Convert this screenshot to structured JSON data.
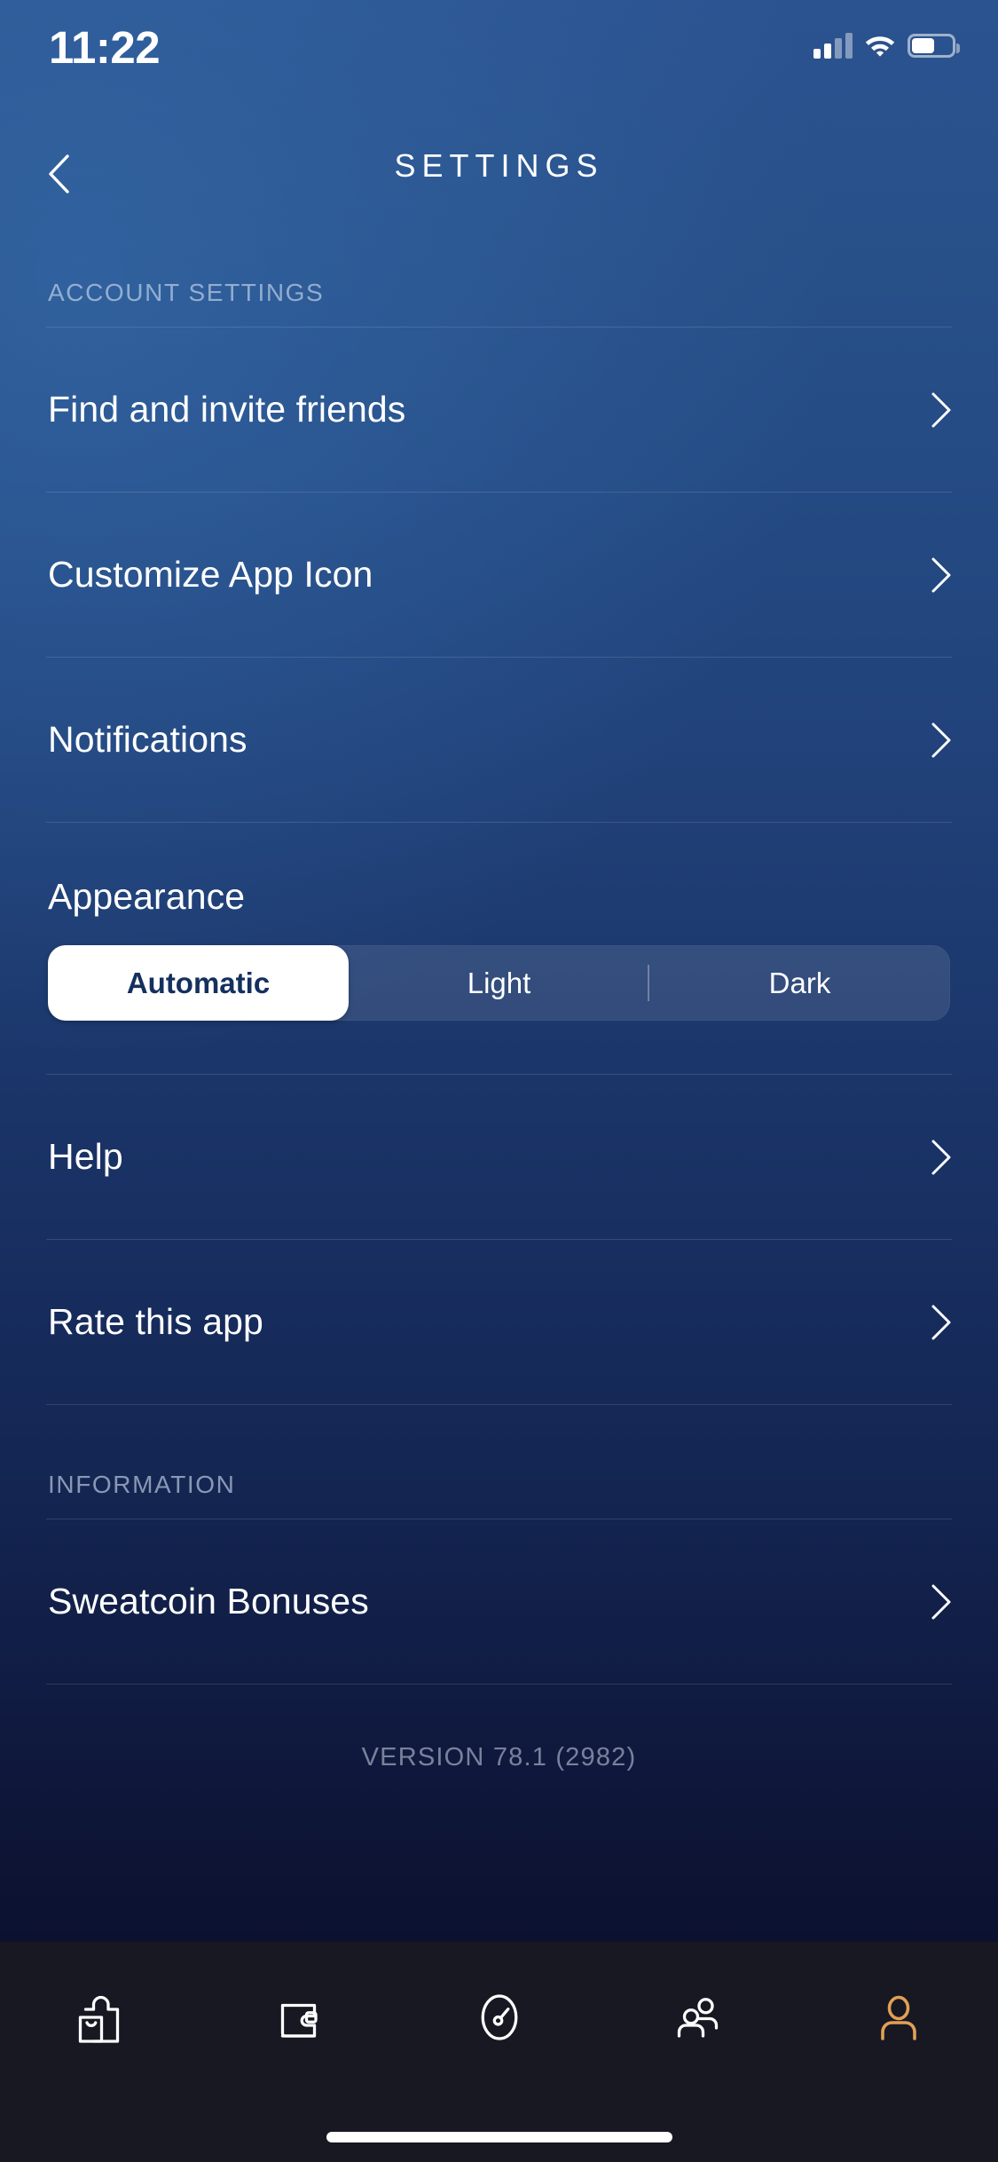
{
  "status_bar": {
    "time": "11:22",
    "signal_icon": "cellular-signal-icon",
    "signal_bars_filled": 2,
    "signal_bars_total": 4,
    "wifi_icon": "wifi-icon",
    "battery_icon": "battery-icon",
    "battery_level_percent": 56
  },
  "header": {
    "back_icon": "chevron-left-icon",
    "title": "SETTINGS"
  },
  "sections": [
    {
      "id": "account-settings",
      "header": "ACCOUNT SETTINGS",
      "rows": [
        {
          "id": "find-and-invite-friends",
          "label": "Find and invite friends",
          "accessory": "chevron-right-icon"
        },
        {
          "id": "customize-app-icon",
          "label": "Customize App Icon",
          "accessory": "chevron-right-icon"
        },
        {
          "id": "notifications",
          "label": "Notifications",
          "accessory": "chevron-right-icon"
        }
      ],
      "appearance": {
        "label": "Appearance",
        "selected": "Automatic",
        "options": [
          "Automatic",
          "Light",
          "Dark"
        ]
      },
      "rows_after": [
        {
          "id": "help",
          "label": "Help",
          "accessory": "chevron-right-icon"
        },
        {
          "id": "rate-this-app",
          "label": "Rate this app",
          "accessory": "chevron-right-icon"
        }
      ]
    },
    {
      "id": "information",
      "header": "INFORMATION",
      "rows": [
        {
          "id": "sweatcoin-bonuses",
          "label": "Sweatcoin Bonuses",
          "accessory": "chevron-right-icon"
        }
      ]
    }
  ],
  "footer": {
    "version": "VERSION 78.1 (2982)"
  },
  "tab_bar": {
    "active_index": 4,
    "active_color": "#e2a054",
    "inactive_color": "#ffffff",
    "items": [
      {
        "id": "shop",
        "icon": "shopping-bag-icon"
      },
      {
        "id": "wallet",
        "icon": "wallet-icon"
      },
      {
        "id": "activity",
        "icon": "speedometer-icon"
      },
      {
        "id": "friends",
        "icon": "people-icon"
      },
      {
        "id": "profile",
        "icon": "person-icon"
      }
    ]
  },
  "colors": {
    "bg_top": "#2b5390",
    "bg_bottom": "#0c1130",
    "tab_bar_bg": "#181823",
    "accent_orange": "#e2a054",
    "selected_pill_bg": "#ffffff",
    "selected_pill_text": "#14305f"
  }
}
